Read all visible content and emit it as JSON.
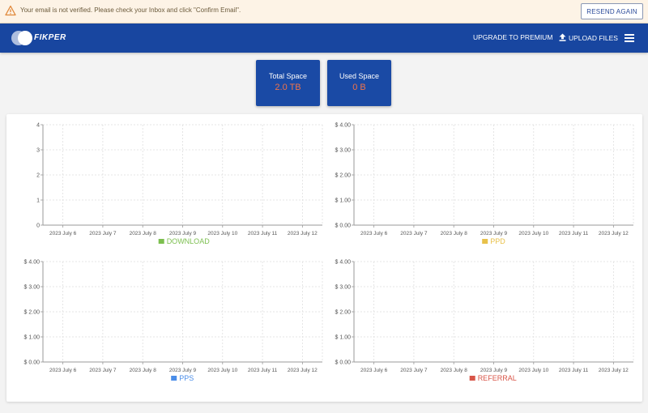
{
  "alert": {
    "message": "Your email is not verified. Please check your Inbox and click \"Confirm Email\".",
    "resend_label": "RESEND AGAIN",
    "icon": "warning-triangle-icon"
  },
  "nav": {
    "brand": "FIKPER",
    "upgrade_label": "UPGRADE TO PREMIUM",
    "upload_label": "UPLOAD FILES",
    "menu_icon": "hamburger-menu-icon"
  },
  "stats": {
    "total_label": "Total Space",
    "total_value": "2.0 TB",
    "used_label": "Used Space",
    "used_value": "0 B"
  },
  "colors": {
    "brand": "#1846a0",
    "stat_value": "#f0734a",
    "download": "#7cbf4f",
    "ppd": "#e8c14a",
    "pps": "#4a8de8",
    "referral": "#d85548"
  },
  "chart_data": [
    {
      "type": "line",
      "legend": "DOWNLOAD",
      "legend_color": "#7cbf4f",
      "x": [
        "2023 July 6",
        "2023 July 7",
        "2023 July 8",
        "2023 July 9",
        "2023 July 10",
        "2023 July 11",
        "2023 July 12"
      ],
      "yticks": [
        "0",
        "1",
        "2",
        "3",
        "4"
      ],
      "ylim": [
        0,
        4
      ],
      "series": [
        {
          "name": "DOWNLOAD",
          "values": []
        }
      ],
      "grid": true,
      "legend_placement": "bottom"
    },
    {
      "type": "line",
      "legend": "PPD",
      "legend_color": "#e8c14a",
      "x": [
        "2023 July 6",
        "2023 July 7",
        "2023 July 8",
        "2023 July 9",
        "2023 July 10",
        "2023 July 11",
        "2023 July 12"
      ],
      "yticks": [
        "$ 0.00",
        "$ 1.00",
        "$ 2.00",
        "$ 3.00",
        "$ 4.00"
      ],
      "ylim": [
        0,
        4
      ],
      "series": [
        {
          "name": "PPD",
          "values": []
        }
      ],
      "grid": true,
      "legend_placement": "bottom"
    },
    {
      "type": "line",
      "legend": "PPS",
      "legend_color": "#4a8de8",
      "x": [
        "2023 July 6",
        "2023 July 7",
        "2023 July 8",
        "2023 July 9",
        "2023 July 10",
        "2023 July 11",
        "2023 July 12"
      ],
      "yticks": [
        "$ 0.00",
        "$ 1.00",
        "$ 2.00",
        "$ 3.00",
        "$ 4.00"
      ],
      "ylim": [
        0,
        4
      ],
      "series": [
        {
          "name": "PPS",
          "values": []
        }
      ],
      "grid": true,
      "legend_placement": "bottom"
    },
    {
      "type": "line",
      "legend": "REFERRAL",
      "legend_color": "#d85548",
      "x": [
        "2023 July 6",
        "2023 July 7",
        "2023 July 8",
        "2023 July 9",
        "2023 July 10",
        "2023 July 11",
        "2023 July 12"
      ],
      "yticks": [
        "$ 0.00",
        "$ 1.00",
        "$ 2.00",
        "$ 3.00",
        "$ 4.00"
      ],
      "ylim": [
        0,
        4
      ],
      "series": [
        {
          "name": "REFERRAL",
          "values": []
        }
      ],
      "grid": true,
      "legend_placement": "bottom"
    }
  ]
}
